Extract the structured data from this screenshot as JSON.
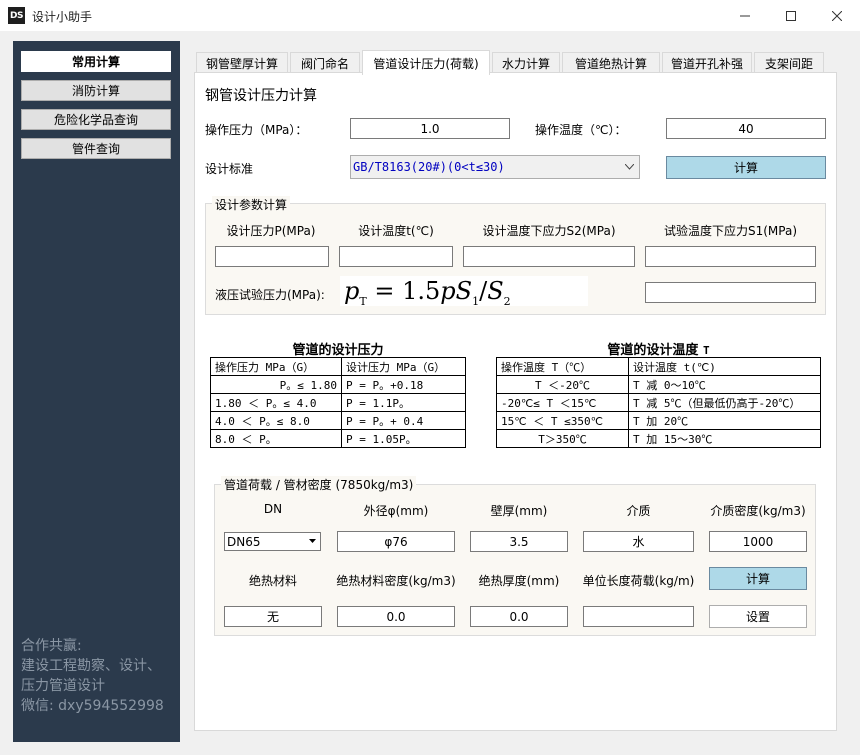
{
  "window": {
    "logo": "DS",
    "title": "设计小助手",
    "minimize_icon": "minimize-icon",
    "maximize_icon": "maximize-icon",
    "close_icon": "close-icon"
  },
  "sidebar": {
    "items": [
      {
        "label": "常用计算",
        "active": true
      },
      {
        "label": "消防计算",
        "active": false
      },
      {
        "label": "危险化学品查询",
        "active": false
      },
      {
        "label": "管件查询",
        "active": false
      }
    ],
    "footer": [
      "合作共赢:",
      "建设工程勘察、设计、",
      "压力管道设计",
      "微信: dxy594552998"
    ]
  },
  "tabs": [
    "钢管壁厚计算",
    "阀门命名",
    "管道设计压力(荷载)",
    "水力计算",
    "管道绝热计算",
    "管道开孔补强",
    "支架间距"
  ],
  "active_tab": 2,
  "main": {
    "section_title": "钢管设计压力计算",
    "op_pressure_label": "操作压力（MPa）：",
    "op_pressure_value": "1.0",
    "op_temp_label": "操作温度（℃）：",
    "op_temp_value": "40",
    "standard_label": "设计标准",
    "standard_value": "GB/T8163(20#)(0<t≤30)",
    "calc_button": "计算"
  },
  "params": {
    "title": "设计参数计算",
    "headers": [
      "设计压力P(MPa)",
      "设计温度t(℃)",
      "设计温度下应力S2(MPa)",
      "试验温度下应力S1(MPa)"
    ],
    "hydro_label": "液压试验压力(MPa):",
    "formula": {
      "lhs": "p",
      "lhs_sub": "T",
      "eq": "=",
      "coef": "1.5",
      "p": "p",
      "s1": "S",
      "s1_sub": "1",
      "slash": "/",
      "s2": "S",
      "s2_sub": "2"
    }
  },
  "pressure_table": {
    "title": "管道的设计压力",
    "header": [
      "操作压力 MPa（G）",
      "设计压力 MPa（G）"
    ],
    "rows": [
      [
        "P。≤ 1.80",
        "P = P。+0.18"
      ],
      [
        "1.80 ＜ P。≤ 4.0",
        "P = 1.1P。"
      ],
      [
        "4.0 ＜ P。≤ 8.0",
        "P = P。+ 0.4"
      ],
      [
        "8.0 ＜ P。",
        "P = 1.05P。"
      ]
    ]
  },
  "temp_table": {
    "title": "管道的设计温度",
    "title_suffix": "T",
    "header": [
      "操作温度 T（℃）",
      "设计温度 t(℃)"
    ],
    "rows": [
      [
        "T ＜-20℃",
        "T 减 0～10℃"
      ],
      [
        "-20℃≤ T ＜15℃",
        "T 减 5℃（但最低仍高于-20℃）"
      ],
      [
        "15℃ ＜ T ≤350℃",
        "T 加 20℃"
      ],
      [
        "T＞350℃",
        "T 加 15～30℃"
      ]
    ]
  },
  "load": {
    "title": "管道荷载 / 管材密度 (7850kg/m3)",
    "row1_headers": [
      "DN",
      "外径φ(mm)",
      "壁厚(mm)",
      "介质",
      "介质密度(kg/m3)"
    ],
    "dn_value": "DN65",
    "outer_diameter": "φ76",
    "wall_thickness": "3.5",
    "medium": "水",
    "medium_density": "1000",
    "row2_headers": [
      "绝热材料",
      "绝热材料密度(kg/m3)",
      "绝热厚度(mm)",
      "单位长度荷载(kg/m)"
    ],
    "calc_button": "计算",
    "insulation": "无",
    "insulation_density": "0.0",
    "insulation_thickness": "0.0",
    "unit_load": "",
    "settings_button": "设置"
  }
}
